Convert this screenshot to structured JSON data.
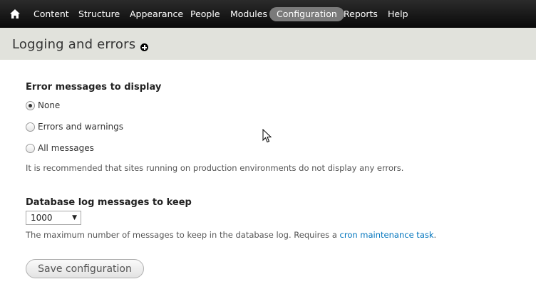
{
  "toolbar": {
    "home_icon": "home-icon",
    "items": [
      {
        "label": "Content"
      },
      {
        "label": "Structure"
      },
      {
        "label": "Appearance"
      },
      {
        "label": "People"
      },
      {
        "label": "Modules"
      },
      {
        "label": "Configuration",
        "active": true
      },
      {
        "label": "Reports"
      },
      {
        "label": "Help"
      }
    ]
  },
  "page": {
    "title": "Logging and errors",
    "shortcut_icon": "add-shortcut-icon"
  },
  "errors": {
    "label": "Error messages to display",
    "options": [
      {
        "label": "None",
        "checked": true
      },
      {
        "label": "Errors and warnings",
        "checked": false
      },
      {
        "label": "All messages",
        "checked": false
      }
    ],
    "description": "It is recommended that sites running on production environments do not display any errors."
  },
  "dblog": {
    "label": "Database log messages to keep",
    "selected": "1000",
    "description_prefix": "The maximum number of messages to keep in the database log. Requires a ",
    "link_text": "cron maintenance task",
    "description_suffix": "."
  },
  "actions": {
    "save_label": "Save configuration"
  },
  "colors": {
    "toolbar_bg": "#0a0a0a",
    "active_pill": "#7a7a7a",
    "title_band": "#e1e2dc",
    "link": "#0074bd"
  }
}
